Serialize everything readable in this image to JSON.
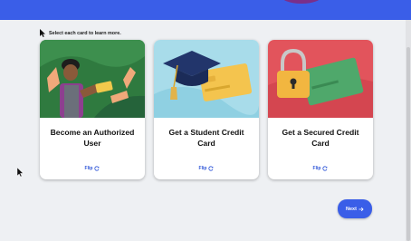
{
  "instruction": "Select each card to learn more.",
  "cards": [
    {
      "title": "Become an Authorized User",
      "flip_label": "Flip"
    },
    {
      "title": "Get a Student Credit Card",
      "flip_label": "Flip"
    },
    {
      "title": "Get a Secured Credit Card",
      "flip_label": "Flip"
    }
  ],
  "next_label": "Next",
  "icons": {
    "cursor": "cursor-pointer-icon",
    "flip": "refresh-icon",
    "next": "arrow-right-icon"
  },
  "colors": {
    "accent": "#3a5ee8",
    "card1_bg": "#2f7a3f",
    "card2_bg": "#a8dcea",
    "card3_bg": "#e2545c"
  }
}
